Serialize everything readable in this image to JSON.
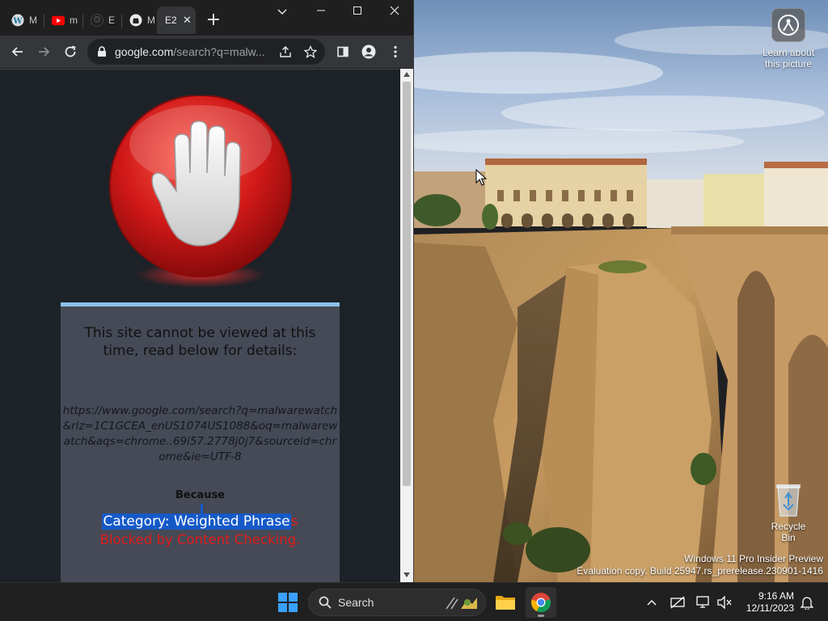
{
  "browser": {
    "tabs": [
      {
        "title": "M",
        "icon": "wordpress-icon"
      },
      {
        "title": "m",
        "icon": "youtube-icon"
      },
      {
        "title": "E",
        "icon": "github-icon"
      },
      {
        "title": "M",
        "icon": "github-icon"
      },
      {
        "title": "E2",
        "icon": "none",
        "active": true
      }
    ],
    "url_host": "google.com",
    "url_path": "/search?q=malw..."
  },
  "blocked_page": {
    "heading": "This site cannot be viewed at this time, read below for details:",
    "blocked_url": "https://www.google.com/search?q=malwarewatch&rlz=1C1GCEA_enUS1074US1088&oq=malwarewatch&aqs=chrome..69i57.2778j0j7&sourceid=chrome&ie=UTF-8",
    "because_label": "Because",
    "category_selected": "Category: Weighted Phrase",
    "category_rest": "s",
    "blocked_reason": "Blocked by Content Checking."
  },
  "desktop": {
    "learn_about_picture": "Learn about this picture",
    "recycle_bin": "Recycle Bin",
    "watermark_line1": "Windows 11 Pro Insider Preview",
    "watermark_line2": "Evaluation copy. Build 25947.rs_prerelease.230901-1416"
  },
  "taskbar": {
    "search_placeholder": "Search",
    "time": "9:16 AM",
    "date": "12/11/2023"
  },
  "colors": {
    "accent_selection": "#1559c8",
    "blocked_red": "#e21b1b",
    "stop_red": "#d01818"
  }
}
